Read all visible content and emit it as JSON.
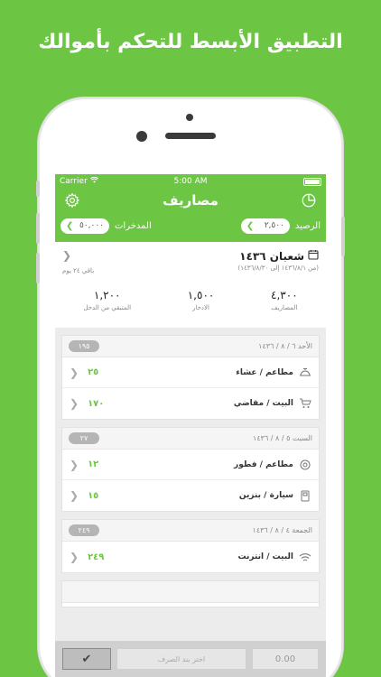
{
  "promo": {
    "headline": "التطبيق الأبسط للتحكم بأموالك"
  },
  "status": {
    "carrier": "Carrier",
    "time": "5:00 AM"
  },
  "nav": {
    "title": "مصاريف",
    "settings_icon": "gear-icon",
    "chart_icon": "pie-chart-icon"
  },
  "balances": {
    "balance_label": "الرصيد",
    "balance_value": "٢,٥٠٠",
    "savings_label": "المدخرات",
    "savings_value": "٥٠,٠٠٠"
  },
  "month": {
    "title": "شعبان ١٤٣٦",
    "range": "(من ١٤٣٦/٨/١ إلى ١٤٣٦/٨/٣٠)",
    "remaining": "باقي ٢٤ يوم",
    "stats": [
      {
        "value": "٤,٣٠٠",
        "label": "المصاريف"
      },
      {
        "value": "١,٥٠٠",
        "label": "الادخار"
      },
      {
        "value": "١,٢٠٠",
        "label": "المتبقي من الدخل"
      }
    ]
  },
  "days": [
    {
      "date": "الأحد ٦ / ٨ / ١٤٣٦",
      "total": "١٩٥",
      "items": [
        {
          "label": "مطاعم / عشاء",
          "amount": "٢٥",
          "icon": "dish-icon"
        },
        {
          "label": "البيت / مقاضي",
          "amount": "١٧٠",
          "icon": "cart-icon"
        }
      ]
    },
    {
      "date": "السبت ٥ / ٨ / ١٤٣٦",
      "total": "٢٧",
      "items": [
        {
          "label": "مطاعم / فطور",
          "amount": "١٢",
          "icon": "breakfast-icon"
        },
        {
          "label": "سيارة / بنزين",
          "amount": "١٥",
          "icon": "fuel-icon"
        }
      ]
    },
    {
      "date": "الجمعة ٤ / ٨ / ١٤٣٦",
      "total": "٢٤٩",
      "items": [
        {
          "label": "البيت / انترنت",
          "amount": "٢٤٩",
          "icon": "wifi-icon"
        }
      ]
    }
  ],
  "bottom": {
    "pick_placeholder": "اختر بند الصرف",
    "amount_placeholder": "0.00",
    "confirm_icon": "checkmark-icon"
  },
  "colors": {
    "accent": "#6cc644"
  }
}
